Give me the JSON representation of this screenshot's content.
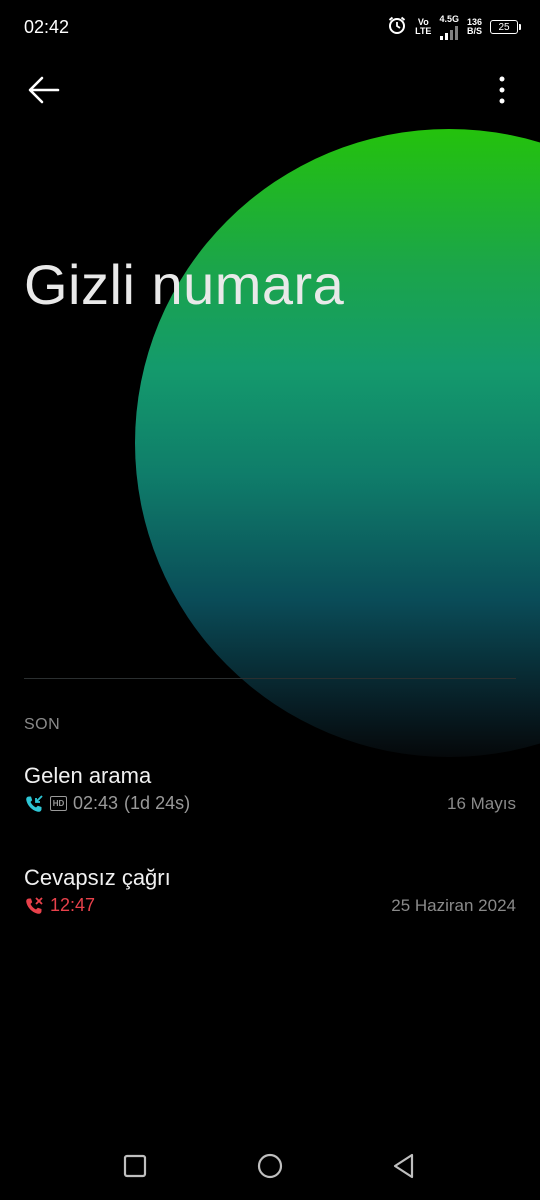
{
  "status_bar": {
    "time": "02:42",
    "volte_top": "Vo",
    "volte_bottom": "LTE",
    "network": "4.5G",
    "speed_value": "136",
    "speed_unit": "B/S",
    "battery": "25",
    "icons": [
      "alarm-icon",
      "signal-icon",
      "battery-icon"
    ]
  },
  "top_bar": {
    "icons": [
      "arrow-back-icon",
      "more-vert-icon"
    ]
  },
  "contact": {
    "name": "Gizli numara"
  },
  "history": {
    "section_title": "SON",
    "calls": [
      {
        "title": "Gelen arama",
        "time": "02:43",
        "duration": "(1d 24s)",
        "date": "16 Mayıs",
        "type": "incoming",
        "hd": "HD",
        "icon": "incoming-call-icon",
        "color": "#2ec7d6"
      },
      {
        "title": "Cevapsız çağrı",
        "time": "12:47",
        "date": "25 Haziran 2024",
        "type": "missed",
        "icon": "missed-call-icon",
        "color": "#e8414b"
      }
    ]
  },
  "nav_bar": {
    "icons": [
      "recents-square-icon",
      "home-circle-icon",
      "back-triangle-icon"
    ]
  },
  "colors": {
    "background": "#000000",
    "orb_top": "#24c20c",
    "orb_middle": "#149a6c",
    "orb_bottom": "#071d24",
    "incoming": "#2ec7d6",
    "missed": "#e8414b",
    "secondary_text": "#8a8a8a"
  }
}
